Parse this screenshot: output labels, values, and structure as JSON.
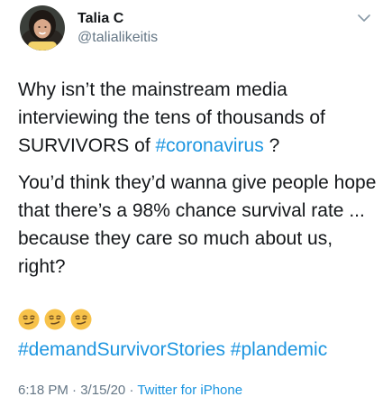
{
  "author": {
    "display_name": "Talia C",
    "handle": "@talialikeitis",
    "avatar_icon": "profile-photo"
  },
  "menu_icon": "chevron-down-icon",
  "tweet": {
    "paragraph1": {
      "before": "Why isn’t the mainstream media interviewing the tens of thousands of SURVIVORS of ",
      "hashtag": "#coronavirus",
      "after": " ?"
    },
    "paragraph2": "You’d think they’d wanna give people hope that there’s a 98% chance survival rate ... because they care so much about us, right?",
    "emojis": [
      "smirk-emoji",
      "smirk-emoji",
      "smirk-emoji"
    ],
    "hashtags": [
      "#demandSurvivorStories",
      "#plandemic"
    ]
  },
  "meta": {
    "time": "6:18 PM",
    "date": "3/15/20",
    "separator": "·",
    "source": "Twitter for iPhone"
  },
  "colors": {
    "link": "#1b95e0",
    "secondary_text": "#657786",
    "primary_text": "#14171a",
    "emoji_face": "#f7c24a"
  }
}
